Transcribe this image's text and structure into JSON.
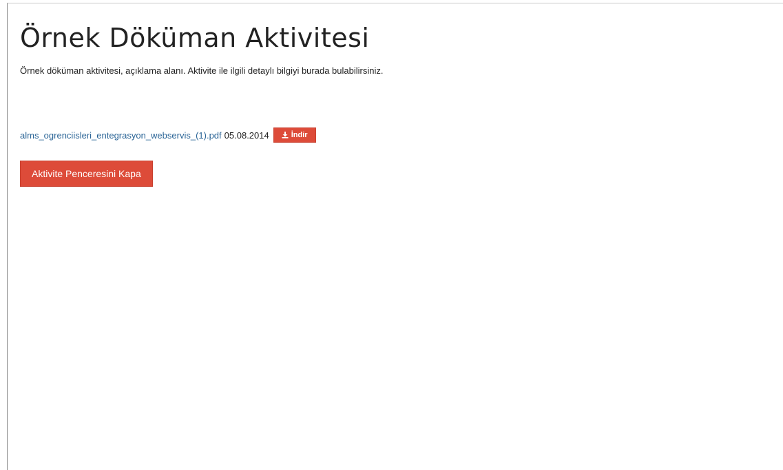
{
  "activity": {
    "title": "Örnek Döküman Aktivitesi",
    "description": "Örnek döküman aktivitesi, açıklama alanı. Aktivite ile ilgili detaylı bilgiyi burada bulabilirsiniz."
  },
  "attachment": {
    "file_name": "alms_ogrenciisleri_entegrasyon_webservis_(1).pdf",
    "date": "05.08.2014",
    "download_label": "İndir",
    "download_icon": "download-icon"
  },
  "actions": {
    "close_label": "Aktivite Penceresini Kapa"
  },
  "colors": {
    "accent": "#dd4b39",
    "link": "#2a6496",
    "text": "#222222"
  }
}
